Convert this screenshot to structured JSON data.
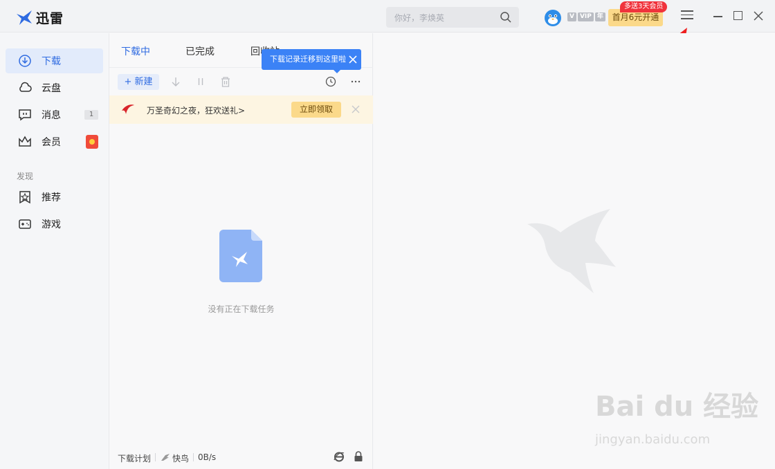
{
  "app": {
    "title": "迅雷"
  },
  "search": {
    "placeholder": "你好，李焕英"
  },
  "account": {
    "vip_label": "VIP",
    "year_label": "年",
    "promo_button": "首月6元开通",
    "promo_badge": "多送3天会员"
  },
  "sidebar": {
    "items": [
      {
        "label": "下载",
        "active": true
      },
      {
        "label": "云盘"
      },
      {
        "label": "消息",
        "badge": "1"
      },
      {
        "label": "会员"
      }
    ],
    "section": "发现",
    "discover": [
      {
        "label": "推荐"
      },
      {
        "label": "游戏"
      }
    ]
  },
  "tabs": [
    {
      "label": "下载中",
      "active": true
    },
    {
      "label": "已完成"
    },
    {
      "label": "回收站"
    }
  ],
  "toolbar": {
    "new_label": "新建"
  },
  "tooltip": {
    "text": "下载记录迁移到这里啦"
  },
  "banner": {
    "text": "万圣奇幻之夜，狂欢送礼>",
    "button": "立即领取"
  },
  "empty": {
    "text": "没有正在下载任务"
  },
  "footer": {
    "plan": "下载计划",
    "bird": "快鸟",
    "speed": "0B/s"
  },
  "watermark": {
    "brand": "Bai du 经验",
    "url": "jingyan.baidu.com"
  },
  "colors": {
    "accent": "#2f6be1",
    "tooltip": "#3b82f6",
    "promo": "#fbd98a",
    "badge": "#f0333c"
  }
}
